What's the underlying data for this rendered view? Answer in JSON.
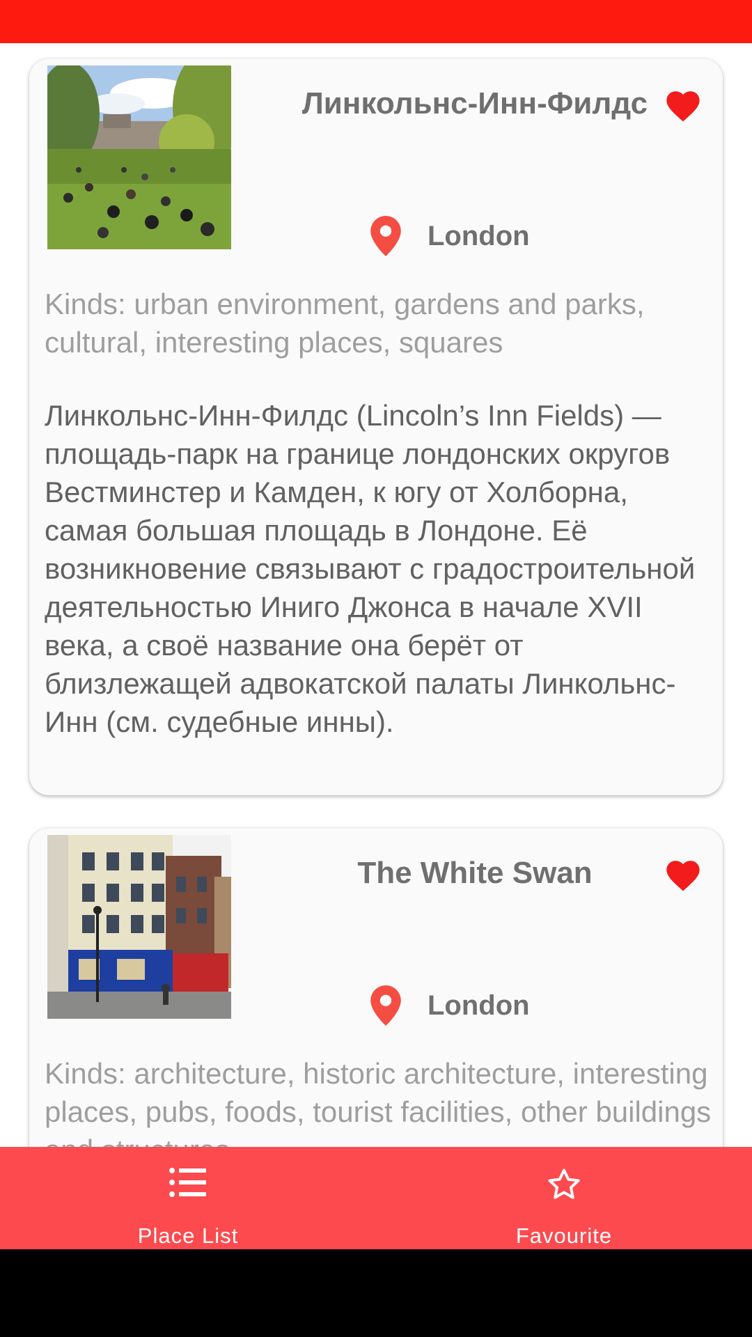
{
  "places": [
    {
      "title": "Линкольнс-Инн-Филдс",
      "location": "London",
      "kinds": "Kinds: urban environment, gardens and parks, cultural, interesting places, squares",
      "description": "Линкольнс-Инн-Филдс (Lincoln’s Inn Fields) — площадь-парк на границе лондонских округов Вестминстер и Камден, к югу от Холборна, самая большая площадь в Лондоне. Её возникновение связывают с градостроительной деятельностью Иниго Джонса в начале XVII века, а своё название она берёт от близлежащей адвокатской палаты Линкольнс-Инн (см. судебные инны).",
      "favourite_icon": "heart-filled-icon"
    },
    {
      "title": "The White Swan",
      "location": "London",
      "kinds": "Kinds: architecture, historic architecture, interesting places, pubs, foods, tourist facilities, other buildings and structures",
      "favourite_icon": "heart-filled-icon"
    }
  ],
  "bottom_nav": {
    "items": [
      {
        "label": "Place List",
        "icon": "list-icon"
      },
      {
        "label": "Favourite",
        "icon": "star-outline-icon"
      }
    ]
  },
  "colors": {
    "status_bar": "#ff1a10",
    "bottom_nav": "#fc4a4e",
    "heart": "#f21c1c",
    "pin": "#f44e43"
  }
}
